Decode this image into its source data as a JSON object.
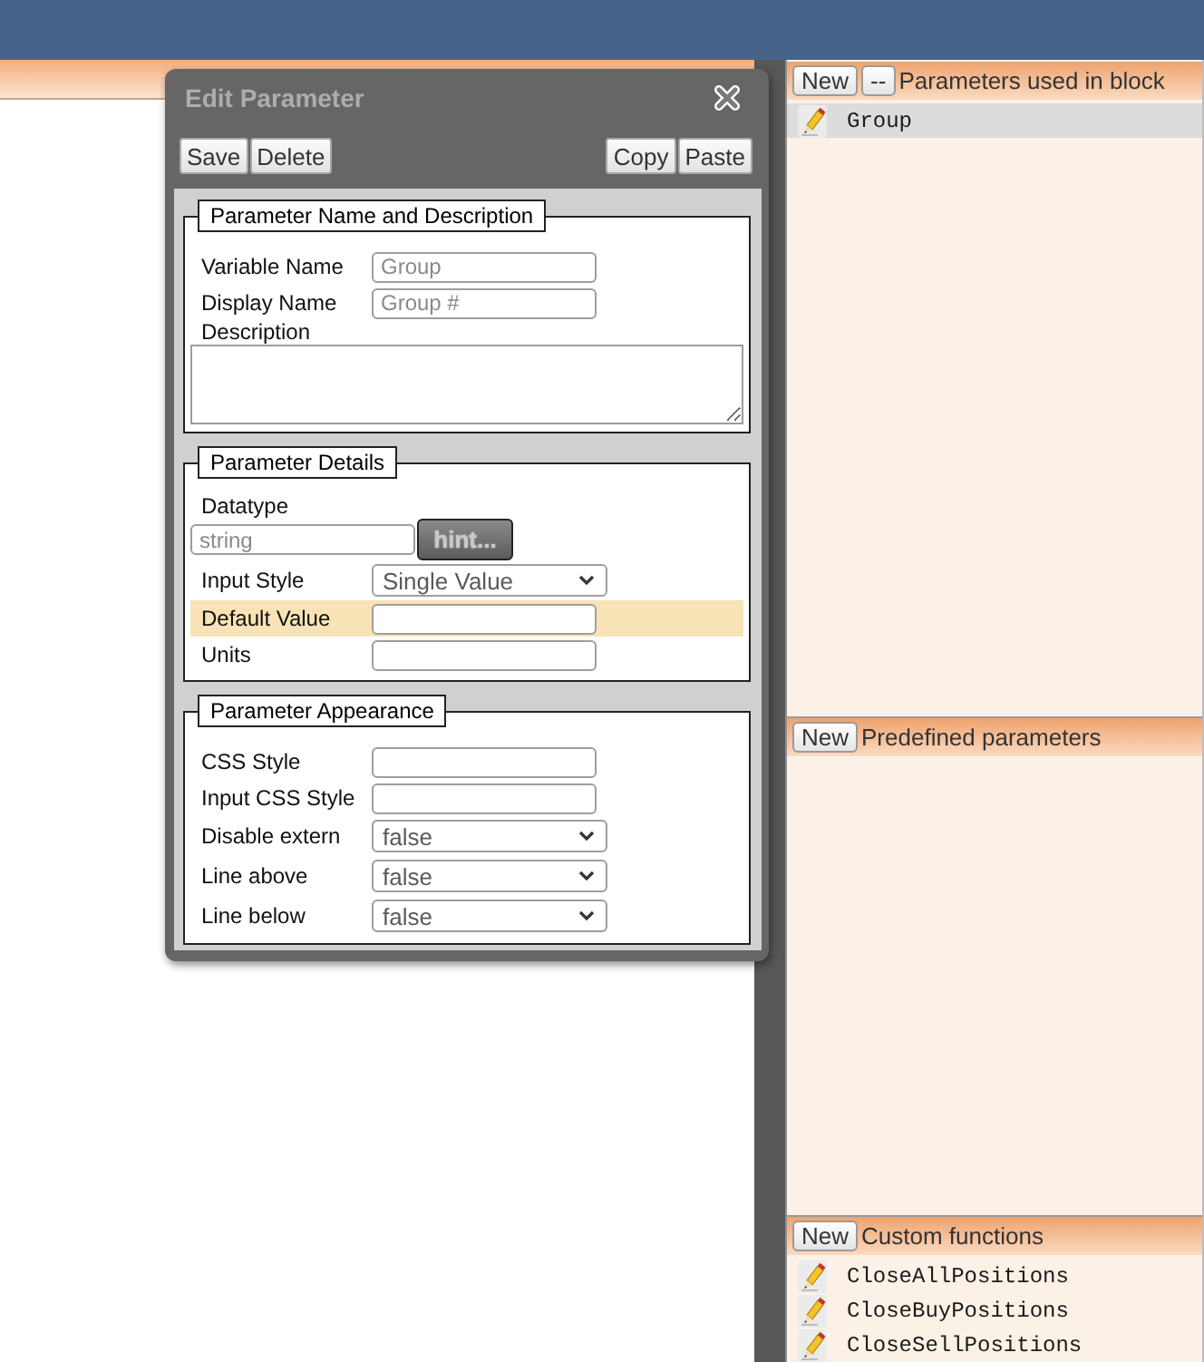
{
  "dialog": {
    "title": "Edit Parameter",
    "left_buttons": [
      "Save",
      "Delete"
    ],
    "right_buttons": [
      "Copy",
      "Paste"
    ],
    "sections": [
      {
        "legend": "Parameter Name and Description",
        "fields": [
          {
            "kind": "text",
            "label": "Variable Name",
            "placeholder": "Group",
            "highlighted": false
          },
          {
            "kind": "text",
            "label": "Display Name",
            "placeholder": "Group #",
            "highlighted": false
          },
          {
            "kind": "textarea",
            "label": "Description",
            "highlighted": false
          }
        ]
      },
      {
        "legend": "Parameter Details",
        "fields": [
          {
            "kind": "hint",
            "label": "Datatype",
            "placeholder": "string",
            "button": "hint...",
            "highlighted": false
          },
          {
            "kind": "select",
            "label": "Input Style",
            "value": "Single Value",
            "highlighted": false
          },
          {
            "kind": "text",
            "label": "Default Value",
            "highlighted": true
          },
          {
            "kind": "text",
            "label": "Units",
            "highlighted": false
          }
        ]
      },
      {
        "legend": "Parameter Appearance",
        "fields": [
          {
            "kind": "text",
            "label": "CSS Style",
            "highlighted": false
          },
          {
            "kind": "text",
            "label": "Input CSS Style",
            "highlighted": false
          },
          {
            "kind": "select",
            "label": "Disable extern",
            "value": "false",
            "highlighted": false
          },
          {
            "kind": "select",
            "label": "Line above",
            "value": "false",
            "highlighted": false
          },
          {
            "kind": "select",
            "label": "Line below",
            "value": "false",
            "highlighted": false
          }
        ]
      }
    ]
  },
  "side_panels": [
    {
      "buttons": [
        "New",
        "--"
      ],
      "title": "Parameters used in block",
      "items": [
        {
          "label": "Group",
          "selected": true
        }
      ]
    },
    {
      "buttons": [
        "New"
      ],
      "title": "Predefined parameters"
    },
    {
      "buttons": [
        "New"
      ],
      "title": "Custom functions",
      "items": [
        {
          "label": "CloseAllPositions",
          "selected": false
        },
        {
          "label": "CloseBuyPositions",
          "selected": false
        },
        {
          "label": "CloseSellPositions",
          "selected": false
        }
      ]
    }
  ]
}
